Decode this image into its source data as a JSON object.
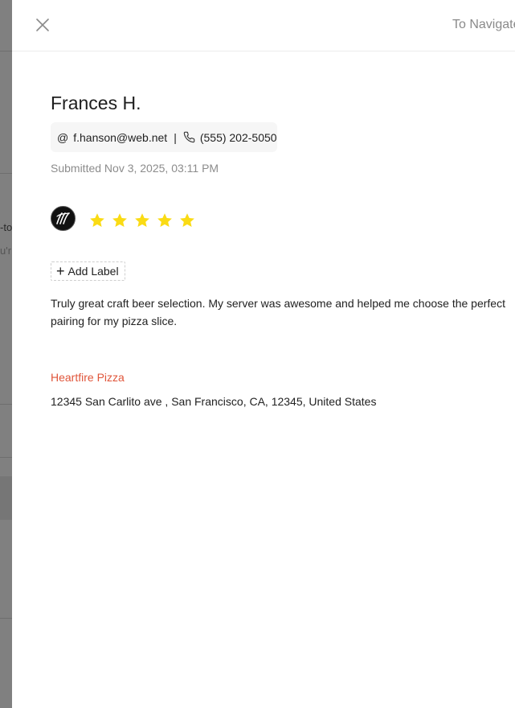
{
  "header": {
    "nav_hint": "To Navigate"
  },
  "review": {
    "customer_name": "Frances H.",
    "email": "f.hanson@web.net",
    "phone": "(555) 202-5050",
    "submitted": "Submitted Nov 3, 2025, 03:11 PM",
    "rating": 5,
    "add_label": "Add Label",
    "text": "Truly great craft beer selection. My server was awesome and helped me choose the perfect pairing for my pizza slice."
  },
  "location": {
    "name": "Heartfire Pizza",
    "address": "12345 San Carlito ave , San Francisco, CA, 12345, United States"
  },
  "colors": {
    "star": "#FADB14",
    "location_link": "#E0553A"
  },
  "icons": {
    "close": "close-icon",
    "email": "at-icon",
    "phone": "phone-icon",
    "avatar": "review-source-logo",
    "add": "plus-icon",
    "star": "star-icon"
  }
}
